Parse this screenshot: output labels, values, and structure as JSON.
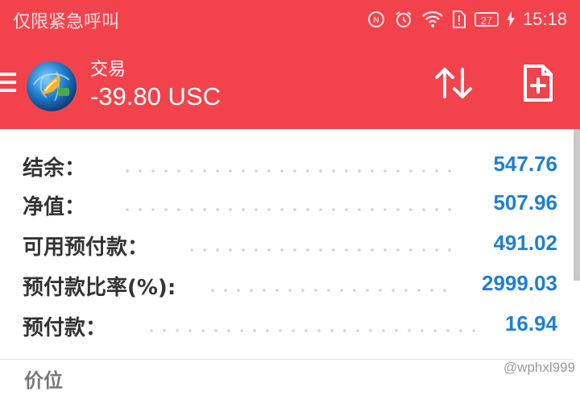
{
  "status_bar": {
    "carrier": "仅限紧急呼叫",
    "battery": "27",
    "time": "15:18"
  },
  "app_bar": {
    "title": "交易",
    "subtitle": "-39.80 USC"
  },
  "account": {
    "rows": [
      {
        "label": "结余：",
        "value": "547.76"
      },
      {
        "label": "净值：",
        "value": "507.96"
      },
      {
        "label": "可用预付款：",
        "value": "491.02"
      },
      {
        "label": "预付款比率(%):",
        "value": "2999.03"
      },
      {
        "label": "预付款：",
        "value": "16.94"
      }
    ]
  },
  "section": {
    "price_label": "价位"
  },
  "watermark": "@wphxl999",
  "colors": {
    "header": "#f2434c",
    "value": "#1f7fd3"
  }
}
